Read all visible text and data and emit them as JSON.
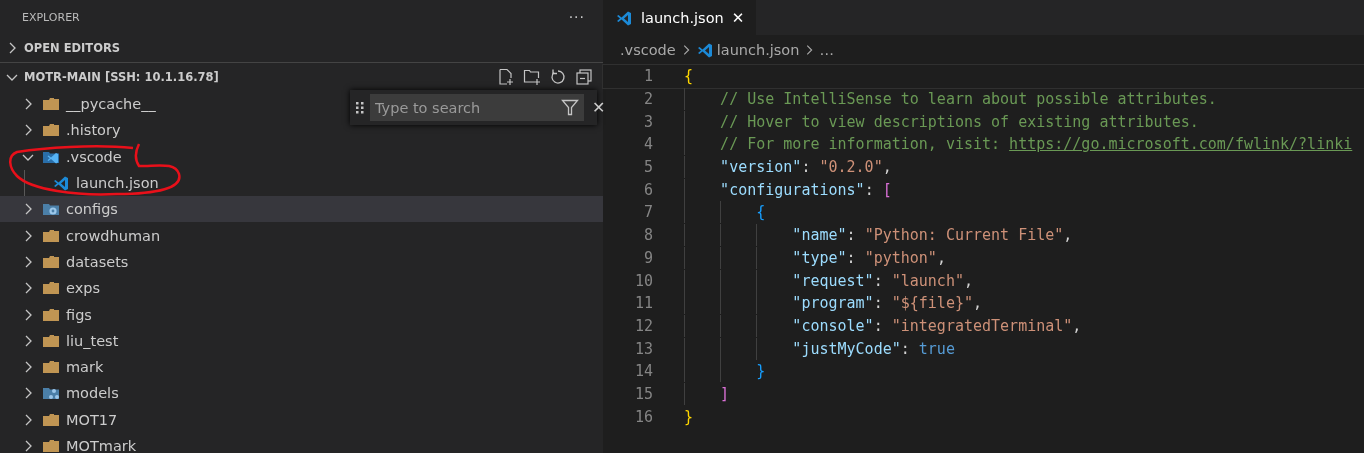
{
  "sidebar": {
    "title": "EXPLORER",
    "more": "···",
    "sections": [
      {
        "label": "OPEN EDITORS",
        "expanded": false
      },
      {
        "label": "MOTR-MAIN [SSH: 10.1.16.78]",
        "expanded": true
      }
    ],
    "tree": [
      {
        "label": "__pycache__",
        "kind": "folder",
        "expanded": false,
        "selected": false
      },
      {
        "label": ".history",
        "kind": "folder",
        "expanded": false,
        "selected": false
      },
      {
        "label": ".vscode",
        "kind": "vscode-folder",
        "expanded": true,
        "selected": false,
        "children": [
          {
            "label": "launch.json",
            "kind": "vscode-file",
            "selected": false
          }
        ]
      },
      {
        "label": "configs",
        "kind": "settings-folder",
        "expanded": false,
        "selected": true
      },
      {
        "label": "crowdhuman",
        "kind": "folder",
        "expanded": false,
        "selected": false
      },
      {
        "label": "datasets",
        "kind": "folder",
        "expanded": false,
        "selected": false
      },
      {
        "label": "exps",
        "kind": "folder",
        "expanded": false,
        "selected": false
      },
      {
        "label": "figs",
        "kind": "folder",
        "expanded": false,
        "selected": false
      },
      {
        "label": "liu_test",
        "kind": "folder",
        "expanded": false,
        "selected": false
      },
      {
        "label": "mark",
        "kind": "folder",
        "expanded": false,
        "selected": false
      },
      {
        "label": "models",
        "kind": "network-folder",
        "expanded": false,
        "selected": false
      },
      {
        "label": "MOT17",
        "kind": "folder",
        "expanded": false,
        "selected": false
      },
      {
        "label": "MOTmark",
        "kind": "folder",
        "expanded": false,
        "selected": false
      }
    ],
    "search": {
      "placeholder": "Type to search",
      "close": "✕"
    }
  },
  "editor": {
    "tabs": [
      {
        "label": "launch.json",
        "close": "✕",
        "selected": true
      }
    ],
    "breadcrumb": [
      {
        "label": ".vscode",
        "kind": "folder"
      },
      {
        "label": "launch.json",
        "kind": "vscode-file"
      },
      {
        "label": "…",
        "kind": "more"
      }
    ],
    "lines": [
      {
        "number": "1",
        "tokens": [
          {
            "kind": "brace1",
            "text": "{"
          }
        ]
      },
      {
        "number": "2",
        "tokens": [
          {
            "kind": "comment",
            "text": "    // Use IntelliSense to learn about possible attributes."
          }
        ]
      },
      {
        "number": "3",
        "tokens": [
          {
            "kind": "comment",
            "text": "    // Hover to view descriptions of existing attributes."
          }
        ]
      },
      {
        "number": "4",
        "tokens": [
          {
            "kind": "comment",
            "text": "    // For more information, visit: "
          },
          {
            "kind": "link",
            "text": "https://go.microsoft.com/fwlink/?linki"
          }
        ]
      },
      {
        "number": "5",
        "tokens": [
          {
            "kind": "key",
            "text": "    \"version\""
          },
          {
            "kind": "punct",
            "text": ": "
          },
          {
            "kind": "string",
            "text": "\"0.2.0\""
          },
          {
            "kind": "punct",
            "text": ","
          }
        ]
      },
      {
        "number": "6",
        "tokens": [
          {
            "kind": "key",
            "text": "    \"configurations\""
          },
          {
            "kind": "punct",
            "text": ": "
          },
          {
            "kind": "brace2",
            "text": "["
          }
        ]
      },
      {
        "number": "7",
        "tokens": [
          {
            "kind": "brace3",
            "text": "        {"
          }
        ]
      },
      {
        "number": "8",
        "tokens": [
          {
            "kind": "key",
            "text": "            \"name\""
          },
          {
            "kind": "punct",
            "text": ": "
          },
          {
            "kind": "string",
            "text": "\"Python: Current File\""
          },
          {
            "kind": "punct",
            "text": ","
          }
        ]
      },
      {
        "number": "9",
        "tokens": [
          {
            "kind": "key",
            "text": "            \"type\""
          },
          {
            "kind": "punct",
            "text": ": "
          },
          {
            "kind": "string",
            "text": "\"python\""
          },
          {
            "kind": "punct",
            "text": ","
          }
        ]
      },
      {
        "number": "10",
        "tokens": [
          {
            "kind": "key",
            "text": "            \"request\""
          },
          {
            "kind": "punct",
            "text": ": "
          },
          {
            "kind": "string",
            "text": "\"launch\""
          },
          {
            "kind": "punct",
            "text": ","
          }
        ]
      },
      {
        "number": "11",
        "tokens": [
          {
            "kind": "key",
            "text": "            \"program\""
          },
          {
            "kind": "punct",
            "text": ": "
          },
          {
            "kind": "string",
            "text": "\"${file}\""
          },
          {
            "kind": "punct",
            "text": ","
          }
        ]
      },
      {
        "number": "12",
        "tokens": [
          {
            "kind": "key",
            "text": "            \"console\""
          },
          {
            "kind": "punct",
            "text": ": "
          },
          {
            "kind": "string",
            "text": "\"integratedTerminal\""
          },
          {
            "kind": "punct",
            "text": ","
          }
        ]
      },
      {
        "number": "13",
        "tokens": [
          {
            "kind": "key",
            "text": "            \"justMyCode\""
          },
          {
            "kind": "punct",
            "text": ": "
          },
          {
            "kind": "bool",
            "text": "true"
          }
        ]
      },
      {
        "number": "14",
        "tokens": [
          {
            "kind": "brace3",
            "text": "        }"
          }
        ]
      },
      {
        "number": "15",
        "tokens": [
          {
            "kind": "brace2",
            "text": "    ]"
          }
        ]
      },
      {
        "number": "16",
        "tokens": [
          {
            "kind": "brace1",
            "text": "}"
          }
        ]
      }
    ]
  }
}
